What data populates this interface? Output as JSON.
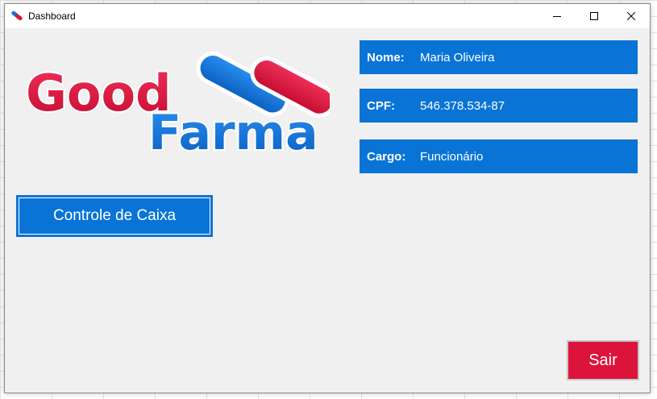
{
  "window": {
    "title": "Dashboard",
    "controls": [
      "minimize-icon",
      "maximize-icon",
      "close-icon"
    ]
  },
  "logo": {
    "word1": "Good",
    "word2": "Farma",
    "colors": {
      "red": "#dc143c",
      "blue": "#0a74d6"
    }
  },
  "user": {
    "name_label": "Nome:",
    "name_value": "Maria Oliveira",
    "cpf_label": "CPF:",
    "cpf_value": "546.378.534-87",
    "role_label": "Cargo:",
    "role_value": "Funcionário"
  },
  "actions": {
    "cash_control_label": "Controle de Caixa",
    "exit_label": "Sair"
  },
  "colors": {
    "accent_blue": "#0a74d6",
    "exit_red": "#dc143c",
    "background": "#f0f0f0"
  }
}
